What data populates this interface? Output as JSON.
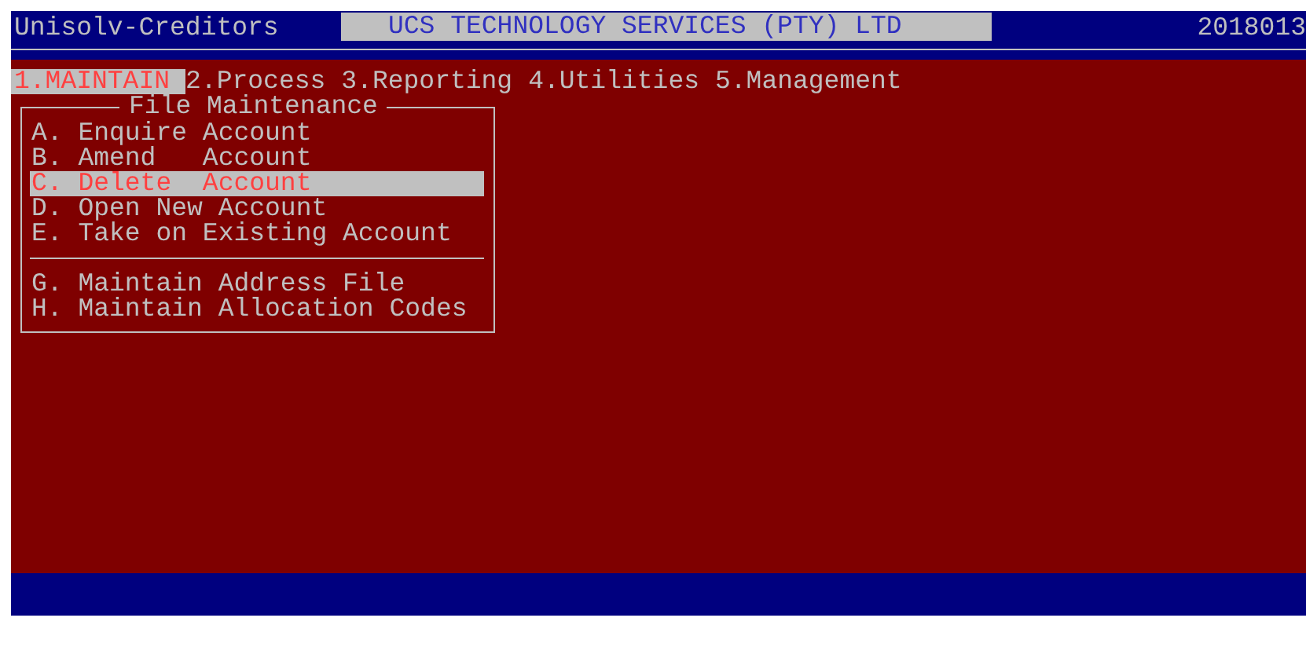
{
  "title_bar": {
    "app_name": "Unisolv-Creditors",
    "company": "UCS TECHNOLOGY SERVICES (PTY) LTD",
    "date": "2018013"
  },
  "menu_bar": [
    {
      "label": "1.MAINTAIN",
      "selected": true
    },
    {
      "label": "2.Process",
      "selected": false
    },
    {
      "label": "3.Reporting",
      "selected": false
    },
    {
      "label": "4.Utilities",
      "selected": false
    },
    {
      "label": "5.Management",
      "selected": false
    }
  ],
  "dropdown": {
    "title": "File Maintenance",
    "items": [
      {
        "kind": "item",
        "label": "A. Enquire Account",
        "selected": false
      },
      {
        "kind": "item",
        "label": "B. Amend   Account",
        "selected": false
      },
      {
        "kind": "item",
        "label": "C. Delete  Account",
        "selected": true
      },
      {
        "kind": "item",
        "label": "D. Open New Account",
        "selected": false
      },
      {
        "kind": "item",
        "label": "E. Take on Existing Account",
        "selected": false
      },
      {
        "kind": "separator"
      },
      {
        "kind": "item",
        "label": "G. Maintain Address File",
        "selected": false
      },
      {
        "kind": "item",
        "label": "H. Maintain Allocation Codes",
        "selected": false
      }
    ]
  }
}
